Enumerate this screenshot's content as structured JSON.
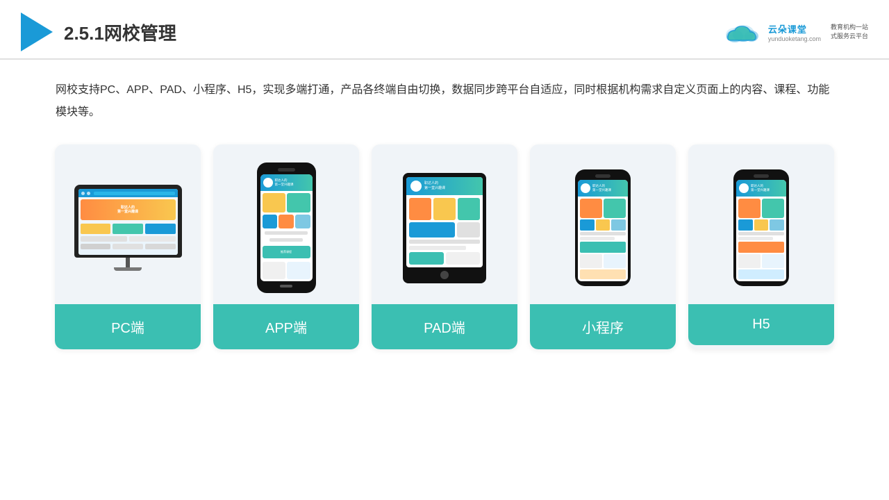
{
  "header": {
    "title": "2.5.1网校管理",
    "brand_name": "云朵课堂",
    "brand_url": "yunduoketang.com",
    "brand_slogan": "教育机构一站\n式服务云平台"
  },
  "description": {
    "text": "网校支持PC、APP、PAD、小程序、H5，实现多端打通，产品各终端自由切换，数据同步跨平台自适应，同时根据机构需求自定义页面上的内容、课程、功能模块等。"
  },
  "cards": [
    {
      "label": "PC端",
      "type": "pc"
    },
    {
      "label": "APP端",
      "type": "phone"
    },
    {
      "label": "PAD端",
      "type": "tablet"
    },
    {
      "label": "小程序",
      "type": "mini-phone"
    },
    {
      "label": "H5",
      "type": "mini-phone2"
    }
  ]
}
